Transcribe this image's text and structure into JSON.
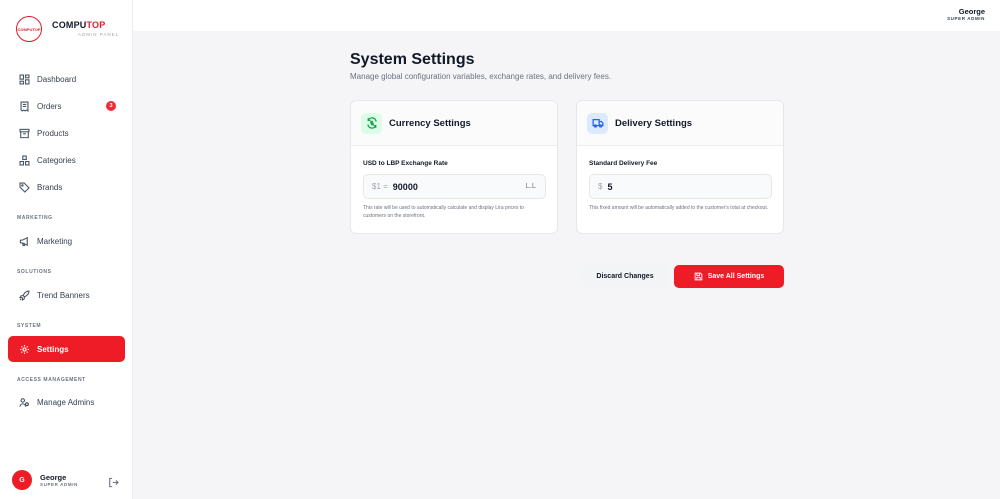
{
  "brand": {
    "logo_text": "COMPUTOP",
    "name_a": "COMPU",
    "name_b": "TOP",
    "subtitle": "ADMIN PANEL"
  },
  "sidebar": {
    "items": [
      {
        "label": "Dashboard",
        "icon": "dashboard-icon"
      },
      {
        "label": "Orders",
        "icon": "receipt-icon",
        "badge": "3"
      },
      {
        "label": "Products",
        "icon": "archive-icon"
      },
      {
        "label": "Categories",
        "icon": "shapes-icon"
      },
      {
        "label": "Brands",
        "icon": "tag-icon"
      },
      {
        "label": "Marketing",
        "icon": "megaphone-icon"
      },
      {
        "label": "Trend Banners",
        "icon": "rocket-icon"
      },
      {
        "label": "Settings",
        "icon": "gear-icon",
        "active": true
      },
      {
        "label": "Manage Admins",
        "icon": "users-icon"
      }
    ],
    "sections": {
      "marketing": "MARKETING",
      "solutions": "SOLUTIONS",
      "system": "SYSTEM",
      "access": "ACCESS MANAGEMENT"
    },
    "user": {
      "initial": "G",
      "name": "George",
      "role": "SUPER ADMIN"
    }
  },
  "topbar": {
    "name": "George",
    "role": "SUPER ADMIN"
  },
  "page": {
    "title": "System Settings",
    "subtitle": "Manage global configuration variables, exchange rates, and delivery fees."
  },
  "currency": {
    "title": "Currency Settings",
    "label": "USD to LBP Exchange Rate",
    "prefix": "$1 =",
    "value": "90000",
    "suffix": "L.L",
    "help": "This rate will be used to automatically calculate and display Lira prices to customers on the storefront."
  },
  "delivery": {
    "title": "Delivery Settings",
    "label": "Standard Delivery Fee",
    "prefix": "$",
    "value": "5",
    "help": "This fixed amount will be automatically added to the customer's total at checkout."
  },
  "actions": {
    "discard": "Discard Changes",
    "save": "Save All Settings"
  },
  "colors": {
    "accent": "#ee1c26",
    "currency_icon_bg": "#dcfce7",
    "delivery_icon_bg": "#dbeafe"
  }
}
